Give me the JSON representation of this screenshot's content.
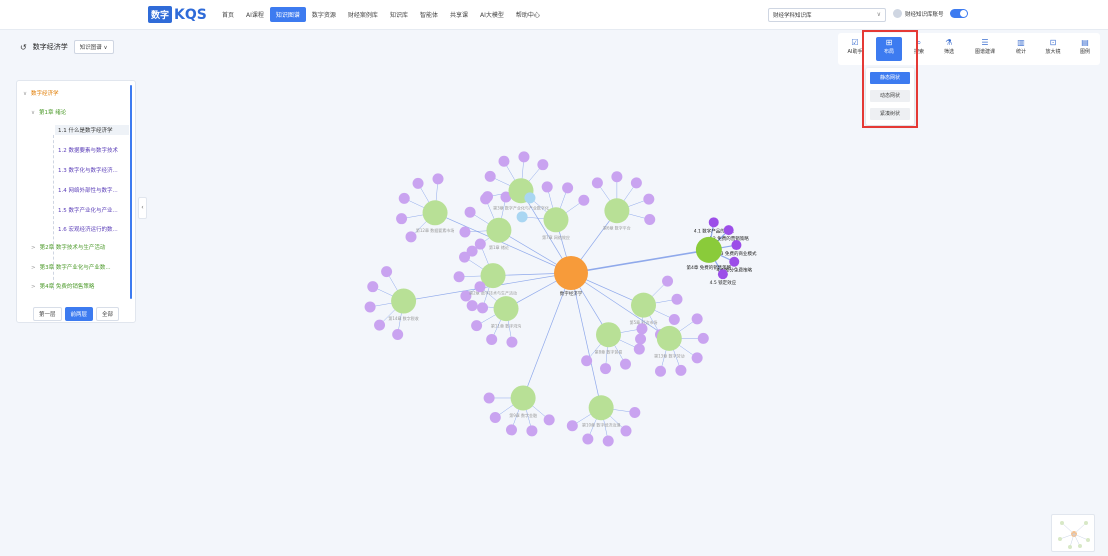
{
  "header": {
    "logo_box": "数字",
    "logo_text": "KQS",
    "nav": [
      "首页",
      "AI课程",
      "知识图谱",
      "数字资源",
      "财经案例库",
      "知识库",
      "智能体",
      "共享课",
      "AI大模型",
      "帮助中心"
    ],
    "nav_active_index": 2,
    "kb_select": "财经学科知识库",
    "user_name": "财经知识库账号"
  },
  "title_row": {
    "title": "数字经济学",
    "mode": "知识图谱"
  },
  "tree": {
    "root": "数字经济学",
    "chapter1": "第1章 绪论",
    "sections": [
      "1.1 什么是数字经济学",
      "1.2 数据要素与数字技术",
      "1.3 数字化与数字经济...",
      "1.4 网络外部性与数字...",
      "1.5 数字产业化与产业...",
      "1.6 宏观经济运行的数..."
    ],
    "chapters": [
      "第2章 数字技术与生产活动",
      "第3章 数字产业化与产业数...",
      "第4章 免费的销售策略"
    ]
  },
  "pager": [
    "第一层",
    "前两层",
    "全部"
  ],
  "toolbar": [
    {
      "label": "AI助手",
      "icon": "ai-icon"
    },
    {
      "label": "布局",
      "icon": "layout-icon"
    },
    {
      "label": "搜索",
      "icon": "search-icon"
    },
    {
      "label": "筛选",
      "icon": "filter-icon"
    },
    {
      "label": "图谱建课",
      "icon": "course-icon"
    },
    {
      "label": "统计",
      "icon": "stats-icon"
    },
    {
      "label": "放大镜",
      "icon": "magnifier-icon"
    },
    {
      "label": "图例",
      "icon": "legend-icon"
    }
  ],
  "layout_menu": [
    "静态网状",
    "动态网状",
    "紧凑树状"
  ],
  "graph": {
    "center": "数字经济学",
    "chapters": [
      "第1章 绪论",
      "第2章 数字技术与生产活动",
      "第3章 数字产业化与产业数字化",
      "第4章 免费的销售策略",
      "第5章 双边市场",
      "第6章 数字平台",
      "第7章 网络效应",
      "第8章 数字贸易",
      "第9章 数字金融",
      "第10章 数字经济治理",
      "第11章 数字鸿沟",
      "第12章 数据要素市场",
      "第13章 数字劳动",
      "第14章 数字税收"
    ],
    "ch4_sections": [
      "4.1 数字产品的特点",
      "4.2 免费的营销策略",
      "4.3 免费的商业模式",
      "4.4 部分免费策略",
      "4.5 锁定效应"
    ]
  },
  "colors": {
    "accent": "#3d7bf0",
    "center_node": "#f79b3a",
    "chapter_node": "#b8e096",
    "section_node": "#c9a3f0",
    "highlight_chapter": "#8acb3a",
    "highlight_section": "#9c4ee8",
    "edge": "#6e8fe6"
  }
}
